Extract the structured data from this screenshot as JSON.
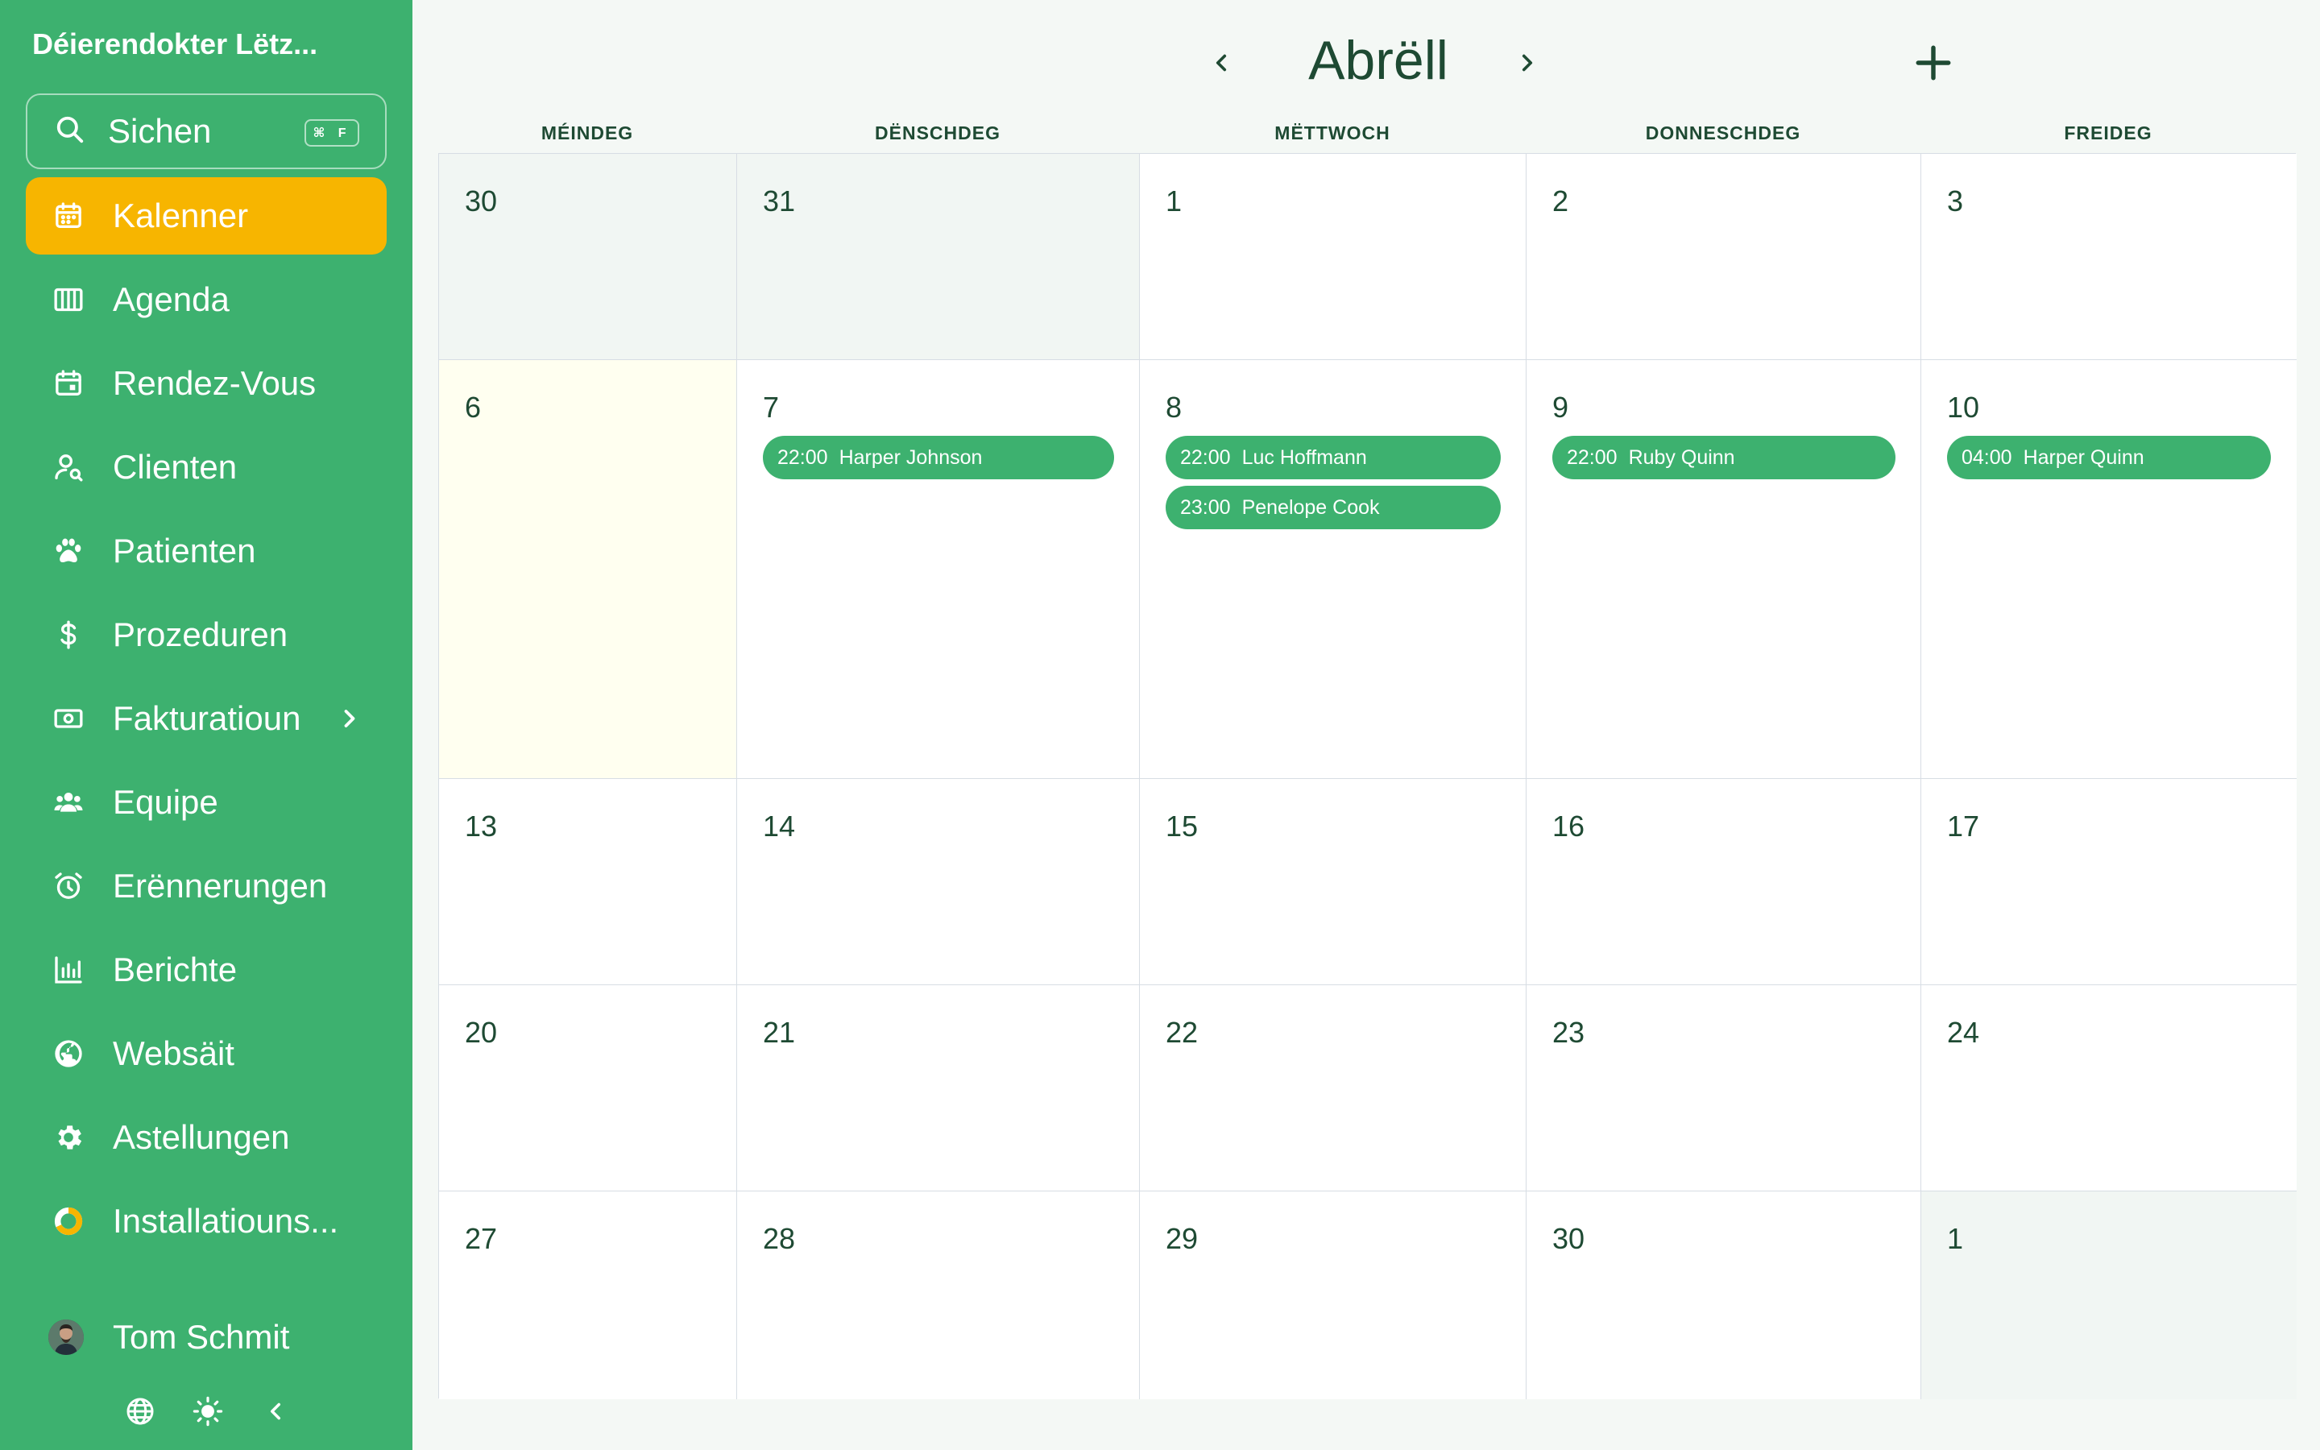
{
  "sidebar": {
    "brand": "Déierendokter Lëtz...",
    "search": {
      "label": "Sichen",
      "shortcut": "⌘ F"
    },
    "items": [
      {
        "label": "Kalenner",
        "icon": "calendar-icon"
      },
      {
        "label": "Agenda",
        "icon": "columns-icon"
      },
      {
        "label": "Rendez-Vous",
        "icon": "calendar-event-icon"
      },
      {
        "label": "Clienten",
        "icon": "user-search-icon"
      },
      {
        "label": "Patienten",
        "icon": "paw-icon"
      },
      {
        "label": "Prozeduren",
        "icon": "dollar-icon"
      },
      {
        "label": "Fakturatioun",
        "icon": "cash-icon"
      },
      {
        "label": "Equipe",
        "icon": "team-icon"
      },
      {
        "label": "Erënnerungen",
        "icon": "alarm-icon"
      },
      {
        "label": "Berichte",
        "icon": "bar-chart-icon"
      },
      {
        "label": "Websäit",
        "icon": "globe-icon"
      },
      {
        "label": "Astellungen",
        "icon": "gear-icon"
      },
      {
        "label": "Installatiouns...",
        "icon": "progress-ring-icon"
      }
    ],
    "user": {
      "name": "Tom Schmit"
    }
  },
  "colors": {
    "sidebar": "#3db16f",
    "active": "#f7b500",
    "event": "#3db16f",
    "text": "#1e4a33",
    "today": "#fffff0"
  },
  "calendar": {
    "month": "Abrëll",
    "weekdays": [
      "MÉINDEG",
      "DËNSCHDEG",
      "MËTTWOCH",
      "DONNESCHDEG",
      "FREIDEG"
    ],
    "weeks": [
      {
        "days": [
          {
            "day": "30",
            "muted": true,
            "events": []
          },
          {
            "day": "31",
            "muted": true,
            "events": []
          },
          {
            "day": "1",
            "events": []
          },
          {
            "day": "2",
            "events": []
          },
          {
            "day": "3",
            "events": []
          }
        ]
      },
      {
        "days": [
          {
            "day": "6",
            "today": true,
            "events": []
          },
          {
            "day": "7",
            "events": [
              {
                "time": "22:00",
                "name": "Harper Johnson"
              }
            ]
          },
          {
            "day": "8",
            "events": [
              {
                "time": "22:00",
                "name": "Luc Hoffmann"
              },
              {
                "time": "23:00",
                "name": "Penelope Cook"
              }
            ]
          },
          {
            "day": "9",
            "events": [
              {
                "time": "22:00",
                "name": "Ruby Quinn"
              }
            ]
          },
          {
            "day": "10",
            "events": [
              {
                "time": "04:00",
                "name": "Harper Quinn"
              }
            ]
          }
        ]
      },
      {
        "days": [
          {
            "day": "13",
            "events": []
          },
          {
            "day": "14",
            "events": []
          },
          {
            "day": "15",
            "events": []
          },
          {
            "day": "16",
            "events": []
          },
          {
            "day": "17",
            "events": []
          }
        ]
      },
      {
        "days": [
          {
            "day": "20",
            "events": []
          },
          {
            "day": "21",
            "events": []
          },
          {
            "day": "22",
            "events": []
          },
          {
            "day": "23",
            "events": []
          },
          {
            "day": "24",
            "events": []
          }
        ]
      },
      {
        "days": [
          {
            "day": "27",
            "events": []
          },
          {
            "day": "28",
            "events": []
          },
          {
            "day": "29",
            "events": []
          },
          {
            "day": "30",
            "events": []
          },
          {
            "day": "1",
            "muted": true,
            "events": []
          }
        ]
      }
    ]
  }
}
